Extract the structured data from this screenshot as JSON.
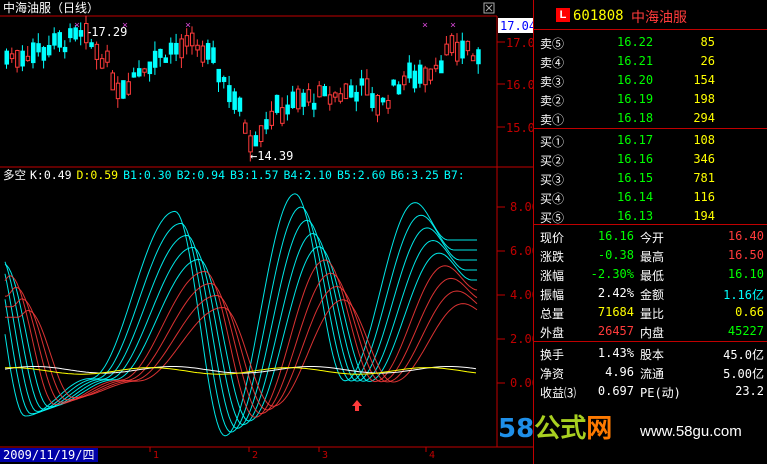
{
  "colors": {
    "up": "#ff3b3b",
    "down": "#00ffff",
    "axis": "#c00000",
    "white": "#ffffff",
    "yellow": "#ffff00",
    "green": "#00ff00",
    "purple": "#cc44cc"
  },
  "kline": {
    "title": "中海油服（日线）",
    "price_labels": [
      "17.00",
      "16.00",
      "15.00"
    ],
    "current_price": "17.04",
    "high_annot": "17.29",
    "low_annot": "14.39"
  },
  "indicator": {
    "name": "多空",
    "legend": [
      {
        "text": "K:0.49",
        "color": "#ffffff"
      },
      {
        "text": "D:0.59",
        "color": "#ffff00"
      },
      {
        "text": "B1:0.30",
        "color": "#00ffff"
      },
      {
        "text": "B2:0.94",
        "color": "#00ffff"
      },
      {
        "text": "B3:1.57",
        "color": "#00ffff"
      },
      {
        "text": "B4:2.10",
        "color": "#00ffff"
      },
      {
        "text": "B5:2.60",
        "color": "#00ffff"
      },
      {
        "text": "B6:3.25",
        "color": "#00ffff"
      },
      {
        "text": "B7:",
        "color": "#00ffff"
      }
    ],
    "y_labels": [
      "8.00",
      "6.00",
      "4.00",
      "2.00",
      "0.00"
    ]
  },
  "date_axis": {
    "date": "2009/11/19/四",
    "months": [
      "1",
      "2",
      "3",
      "4"
    ]
  },
  "quote": {
    "badge": "L",
    "code": "601808",
    "name": "中海油服",
    "sell": [
      {
        "label": "卖⑤",
        "price": "16.22",
        "vol": "85"
      },
      {
        "label": "卖④",
        "price": "16.21",
        "vol": "26"
      },
      {
        "label": "卖③",
        "price": "16.20",
        "vol": "154"
      },
      {
        "label": "卖②",
        "price": "16.19",
        "vol": "198"
      },
      {
        "label": "卖①",
        "price": "16.18",
        "vol": "294"
      }
    ],
    "buy": [
      {
        "label": "买①",
        "price": "16.17",
        "vol": "108"
      },
      {
        "label": "买②",
        "price": "16.16",
        "vol": "346"
      },
      {
        "label": "买③",
        "price": "16.15",
        "vol": "781"
      },
      {
        "label": "买④",
        "price": "16.14",
        "vol": "116"
      },
      {
        "label": "买⑤",
        "price": "16.13",
        "vol": "194"
      }
    ],
    "stats": [
      {
        "l1": "现价",
        "v1": "16.16",
        "c1": "#00ff00",
        "l2": "今开",
        "v2": "16.40",
        "c2": "#ff3b3b"
      },
      {
        "l1": "涨跌",
        "v1": "-0.38",
        "c1": "#00ff00",
        "l2": "最高",
        "v2": "16.50",
        "c2": "#ff3b3b"
      },
      {
        "l1": "涨幅",
        "v1": "-2.30%",
        "c1": "#00ff00",
        "l2": "最低",
        "v2": "16.10",
        "c2": "#00ff00"
      },
      {
        "l1": "振幅",
        "v1": "2.42%",
        "c1": "#ffffff",
        "l2": "金额",
        "v2": "1.16亿",
        "c2": "#00ffff"
      },
      {
        "l1": "总量",
        "v1": "71684",
        "c1": "#ffff00",
        "l2": "量比",
        "v2": "0.66",
        "c2": "#ffff00"
      },
      {
        "l1": "外盘",
        "v1": "26457",
        "c1": "#ff3b3b",
        "l2": "内盘",
        "v2": "45227",
        "c2": "#00ff00"
      }
    ],
    "stats2": [
      {
        "l1": "换手",
        "v1": "1.43%",
        "l2": "股本",
        "v2": "45.0亿"
      },
      {
        "l1": "净资",
        "v1": "4.96",
        "l2": "流通",
        "v2": "5.00亿"
      },
      {
        "l1": "收益⑶",
        "v1": "0.697",
        "l2": "PE(动)",
        "v2": "23.2"
      }
    ]
  },
  "watermark": {
    "brand_a": "58",
    "brand_b": "公式",
    "brand_c": "网",
    "url": "www.58gu.com"
  }
}
